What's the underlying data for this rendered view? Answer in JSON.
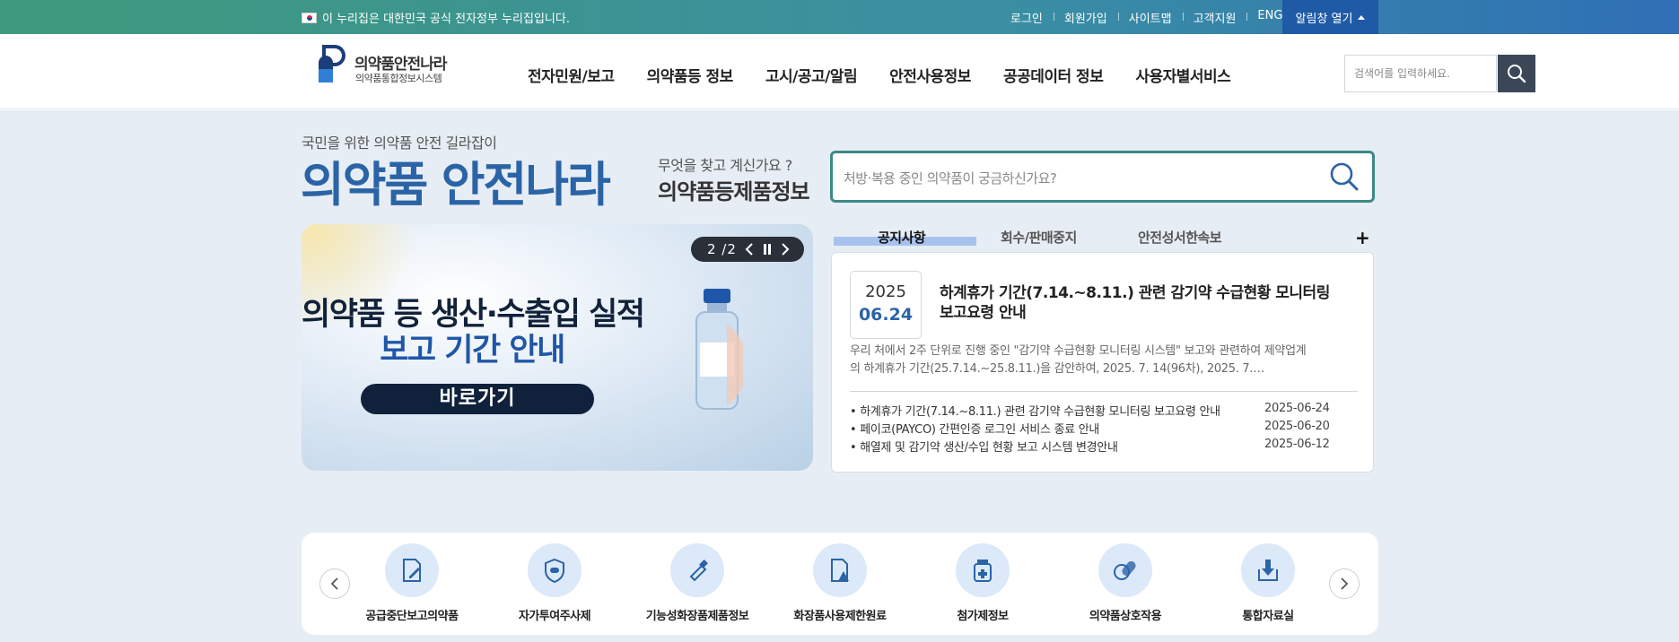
{
  "topbar": {
    "gov_notice": "이 누리집은 대한민국 공식 전자정부 누리집입니다.",
    "links": [
      "로그인",
      "회원가입",
      "사이트맵",
      "고객지원",
      "ENG"
    ],
    "alert_toggle": "알림창 열기"
  },
  "logo": {
    "name": "의약품안전나라",
    "subtitle": "의약품통합정보시스템"
  },
  "nav": [
    "전자민원/보고",
    "의약품등 정보",
    "고시/공고/알림",
    "안전사용정보",
    "공공데이터 정보",
    "사용자별서비스"
  ],
  "header_search": {
    "placeholder": "검색어를 입력하세요."
  },
  "hero": {
    "tagline": "국민을 위한 의약품 안전 길라잡이",
    "title": "의약품 안전나라",
    "question": "무엇을 찾고 계신가요 ?",
    "category": "의약품등제품정보",
    "search_placeholder": "처방·복용 중인 의약품이 궁금하신가요?"
  },
  "banner": {
    "line1": "의약품 등 생산·수출입 실적",
    "line2": "보고 기간 안내",
    "button": "바로가기",
    "pager": "2 /2"
  },
  "tabs": [
    "공지사항",
    "회수/판매중지",
    "안전성서한속보"
  ],
  "featured_notice": {
    "year": "2025",
    "date": "06.24",
    "title": "하계휴가 기간(7.14.~8.11.) 관련 감기약 수급현황 모니터링 보고요령 안내",
    "summary": "우리 처에서 2주 단위로 진행 중인 \"감기약 수급현황 모니터링 시스템\" 보고와 관련하여 제약업계의 하계휴가 기간(25.7.14.~25.8.11.)을 감안하여,   2025. 7. 14(96차), 2025. 7.…"
  },
  "notices": [
    {
      "title": "하계휴가 기간(7.14.~8.11.) 관련 감기약 수급현황 모니터링 보고요령 안내",
      "date": "2025-06-24"
    },
    {
      "title": "페이코(PAYCO) 간편인증 로그인 서비스 종료 안내",
      "date": "2025-06-20"
    },
    {
      "title": "해열제 및 감기약 생산/수입 현황 보고 시스템 변경안내",
      "date": "2025-06-12"
    }
  ],
  "quick_menu": [
    {
      "label": "공급중단보고의약품",
      "icon": "document-pen-icon"
    },
    {
      "label": "자가투여주사제",
      "icon": "shield-pill-icon"
    },
    {
      "label": "기능성화장품제품정보",
      "icon": "cosmetic-tube-icon"
    },
    {
      "label": "화장품사용제한원료",
      "icon": "document-warning-icon"
    },
    {
      "label": "첨가제정보",
      "icon": "medicine-bottle-icon"
    },
    {
      "label": "의약품상호작용",
      "icon": "capsule-icon"
    },
    {
      "label": "통합자료실",
      "icon": "download-archive-icon"
    }
  ],
  "colors": {
    "brand_blue": "#2b64a6",
    "search_border": "#3b8a86",
    "alert_button": "#1f5aa6",
    "tab_highlight": "#a8c2ee"
  }
}
